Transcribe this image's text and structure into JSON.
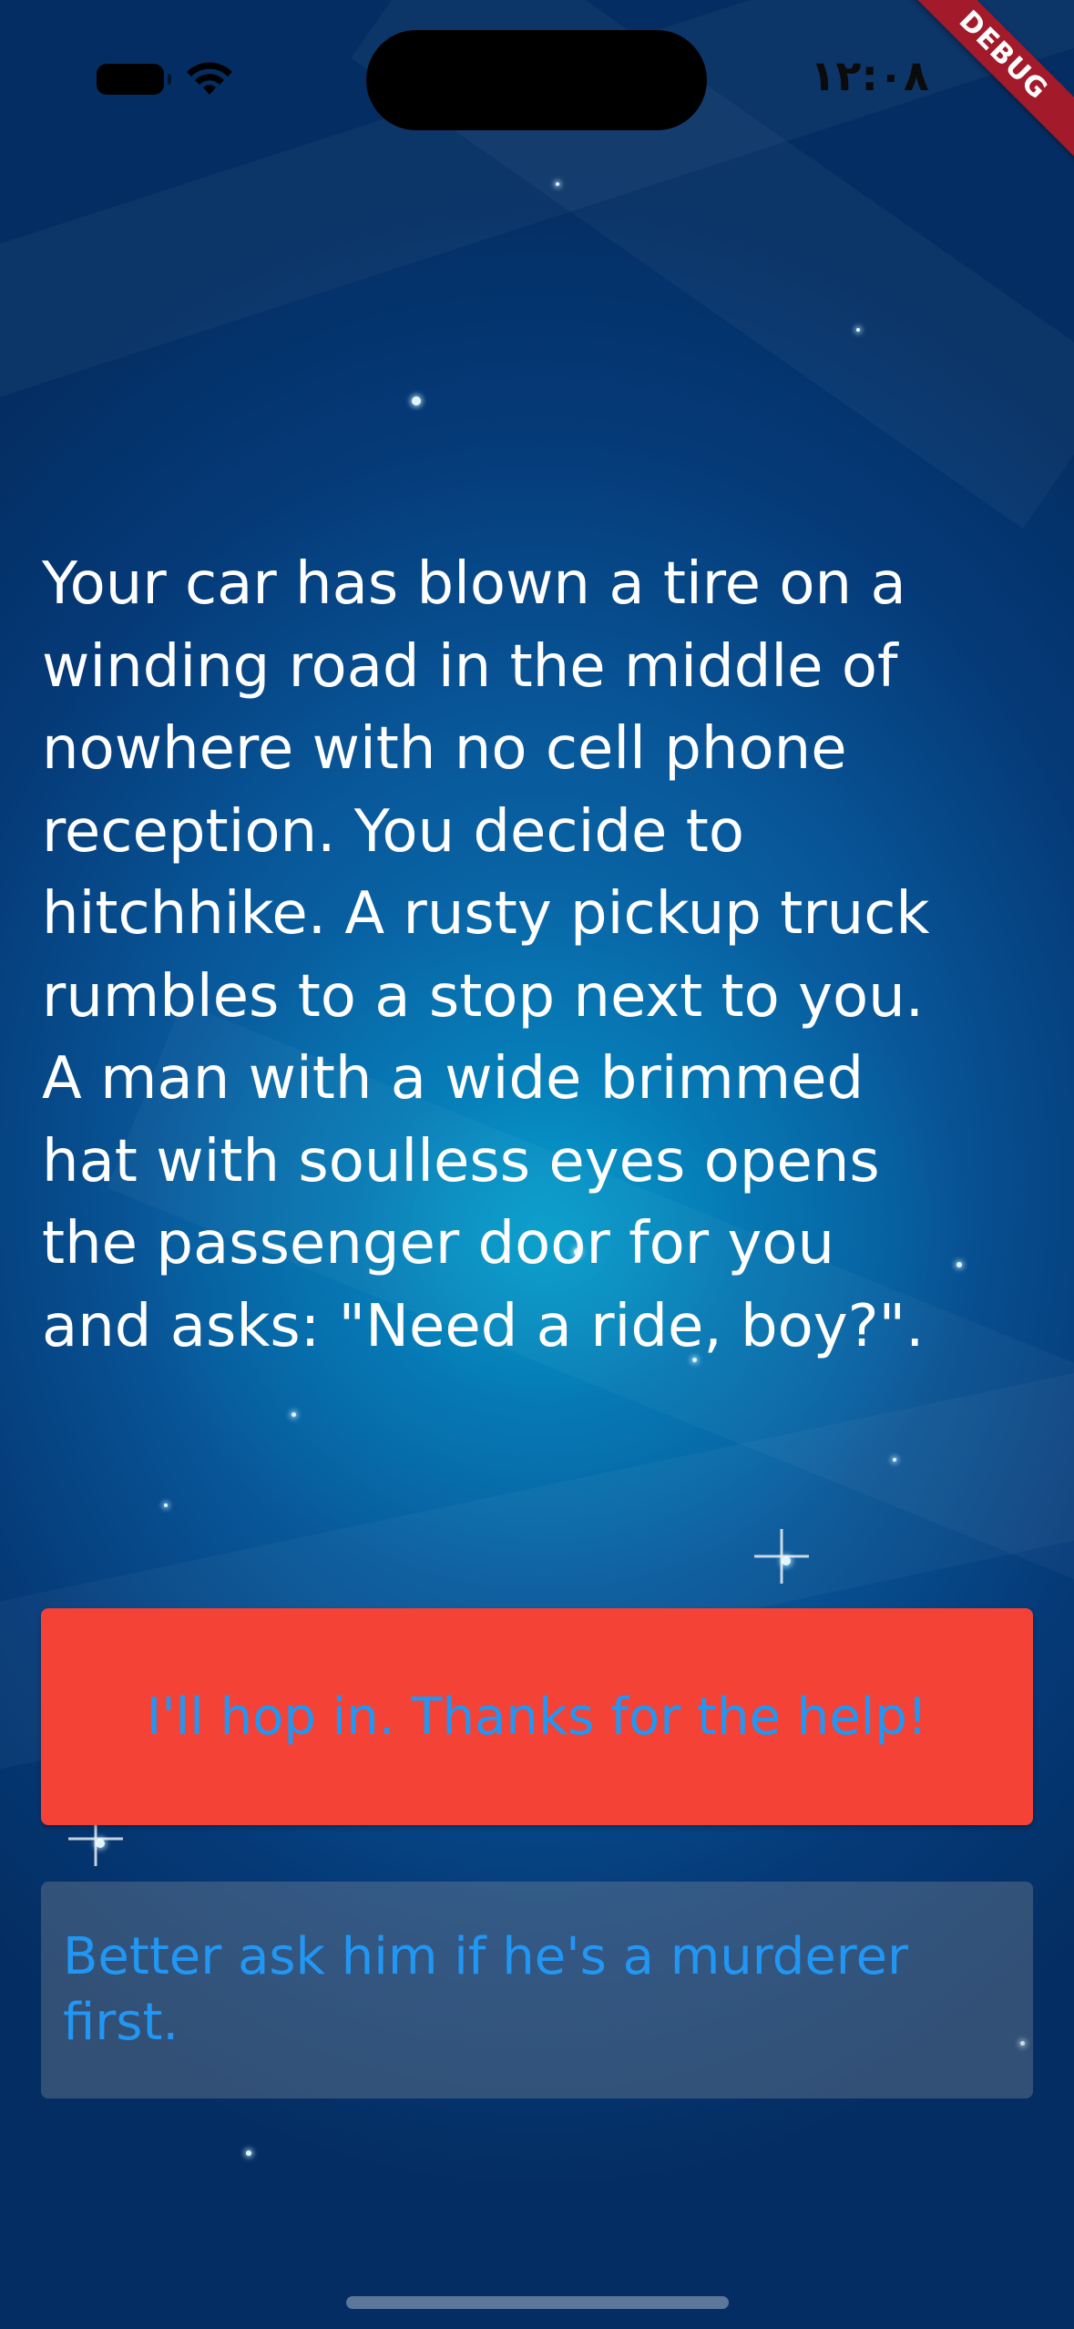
{
  "status_bar": {
    "time": "۱۲:۰۸",
    "debug_label": "DEBUG",
    "icons": [
      "battery-icon",
      "wifi-icon"
    ]
  },
  "story": {
    "text": "Your car has blown a tire on a\nwinding road in the middle of\nnowhere with no cell phone\nreception. You decide to\nhitchhike. A rusty pickup truck\nrumbles to a stop next to you.\nA man with a wide brimmed\nhat with soulless eyes opens\nthe passenger door for you\nand asks: \"Need a ride, boy?\"."
  },
  "choices": {
    "choice1_label": "I'll hop in. Thanks for the help!",
    "choice2_label": "Better ask him if he's a murderer first."
  },
  "colors": {
    "choice1_bg": "#f44336",
    "choice_text": "#2196f3",
    "story_text": "#ffffff",
    "debug_banner": "#a31a2a"
  }
}
